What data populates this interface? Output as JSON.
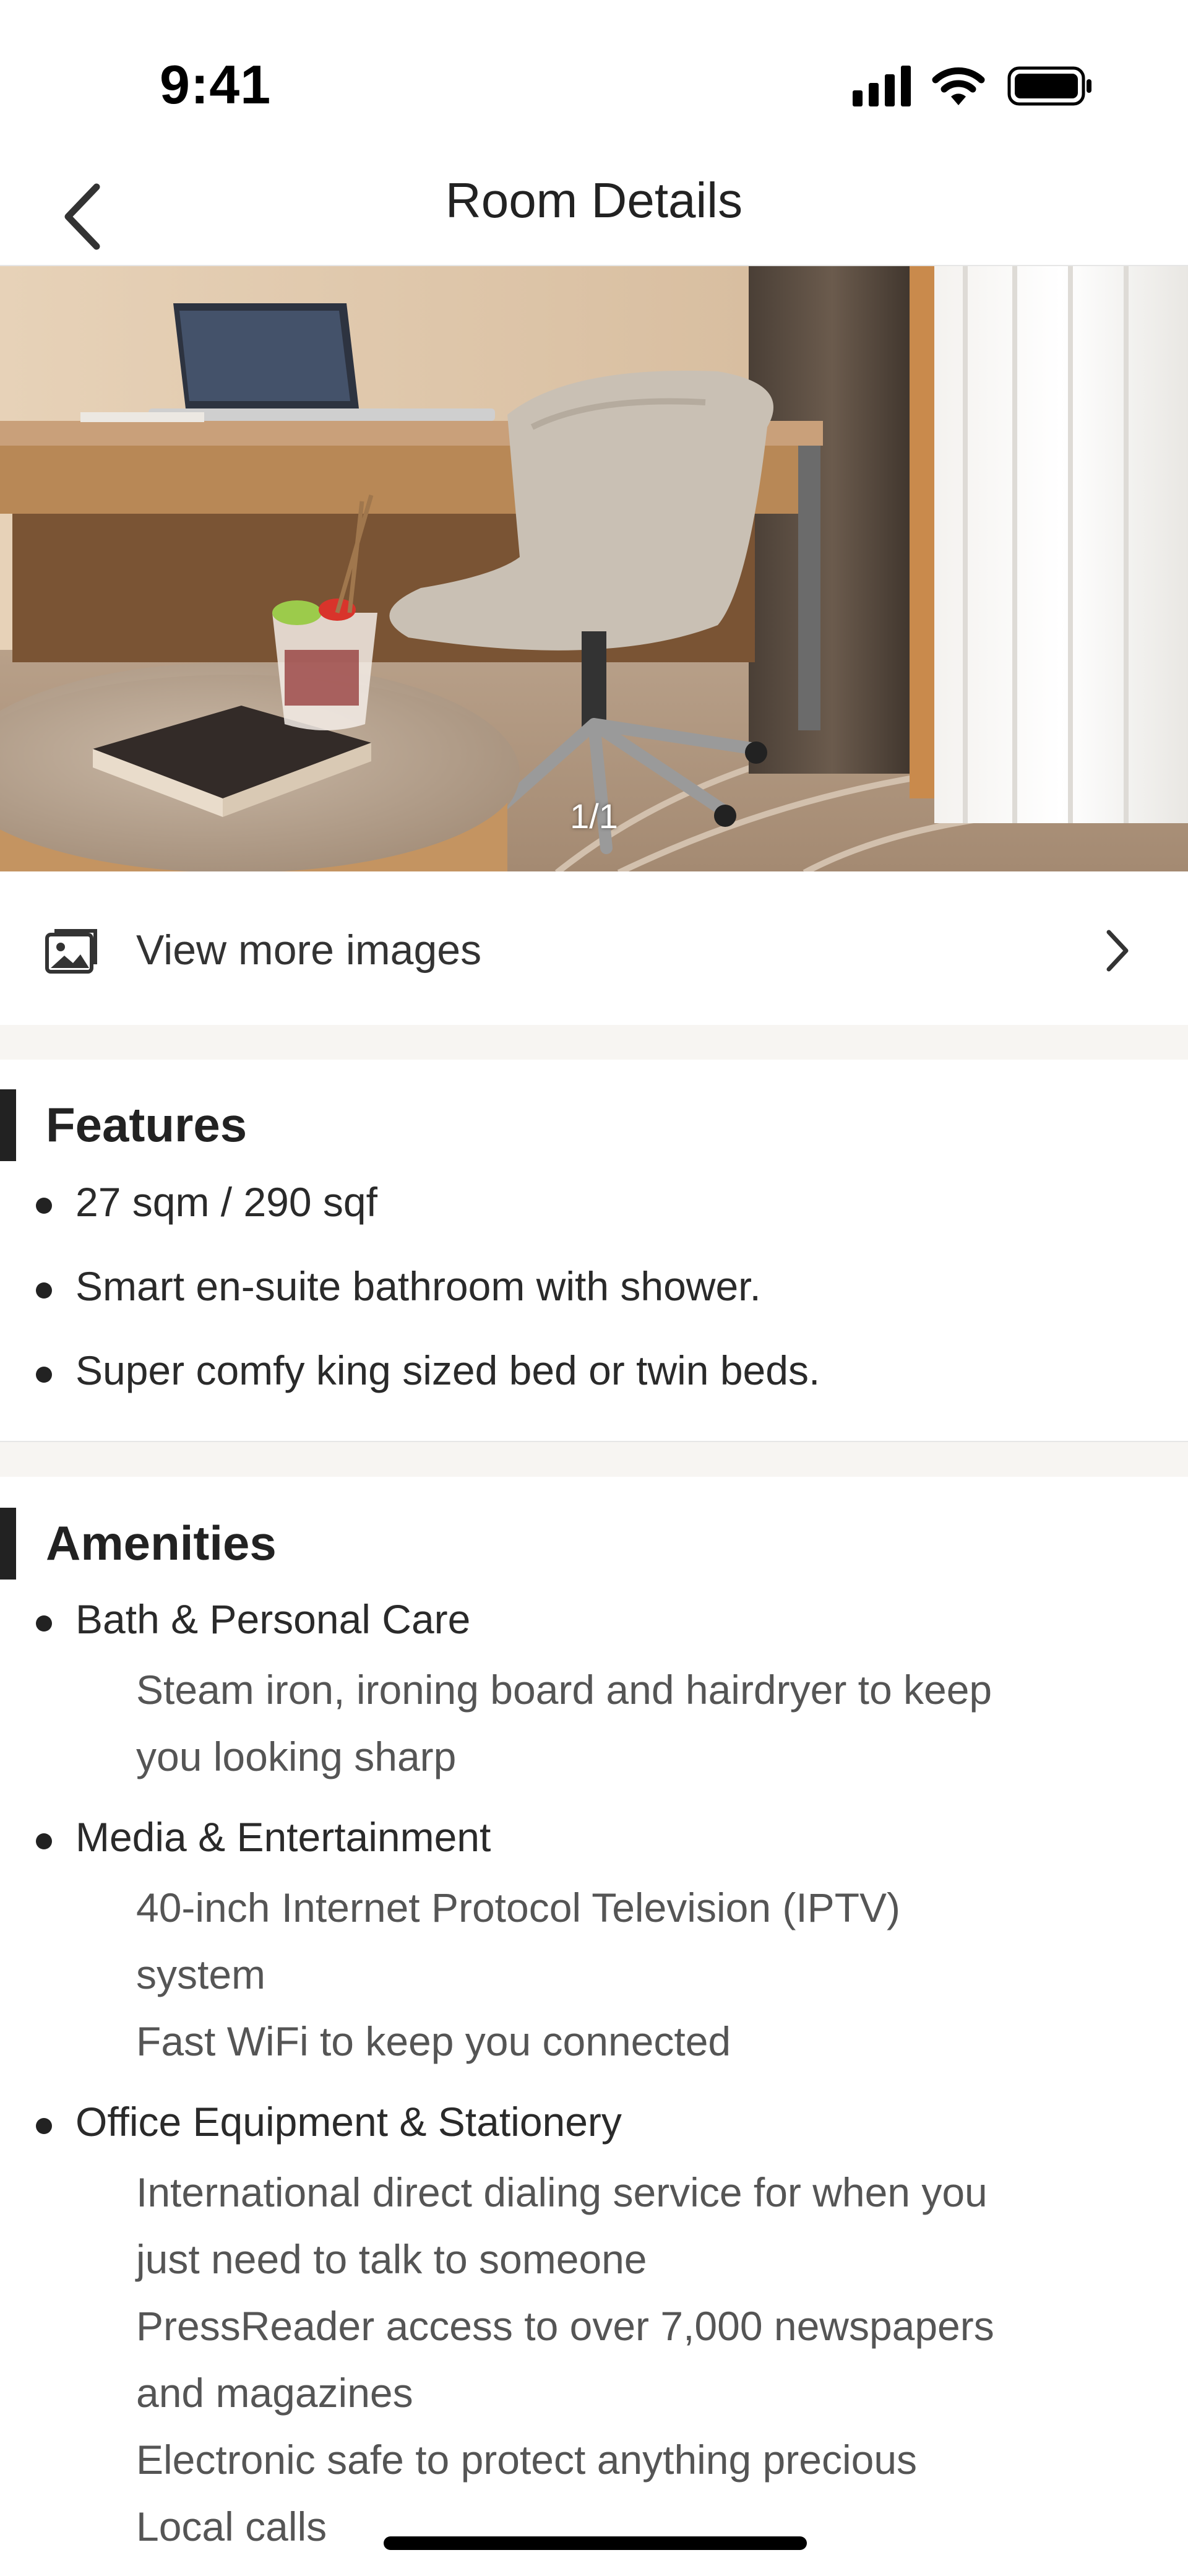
{
  "status_bar": {
    "time": "9:41"
  },
  "nav": {
    "title": "Room Details"
  },
  "gallery": {
    "counter": "1/1"
  },
  "view_more": {
    "label": "View more images"
  },
  "features": {
    "heading": "Features",
    "items": [
      "27 sqm / 290 sqf",
      "Smart en-suite bathroom with shower.",
      "Super comfy king sized bed or twin beds."
    ]
  },
  "amenities": {
    "heading": "Amenities",
    "groups": [
      {
        "title": "Bath & Personal Care",
        "lines": [
          "Steam iron, ironing board and hairdryer to keep",
          "you looking sharp"
        ]
      },
      {
        "title": "Media & Entertainment",
        "lines": [
          "40-inch Internet Protocol Television (IPTV)",
          "system",
          "Fast WiFi to keep you connected"
        ]
      },
      {
        "title": "Office Equipment & Stationery",
        "lines": [
          "International direct dialing service for when you",
          "just need to talk to someone",
          "PressReader access to over 7,000 newspapers",
          "and magazines",
          "Electronic safe to protect anything precious",
          "Local calls"
        ]
      }
    ]
  },
  "colors": {
    "accent_bar": "#222222",
    "section_gap": "#f7f5f2",
    "text_primary": "#222222",
    "text_secondary": "#555555"
  }
}
